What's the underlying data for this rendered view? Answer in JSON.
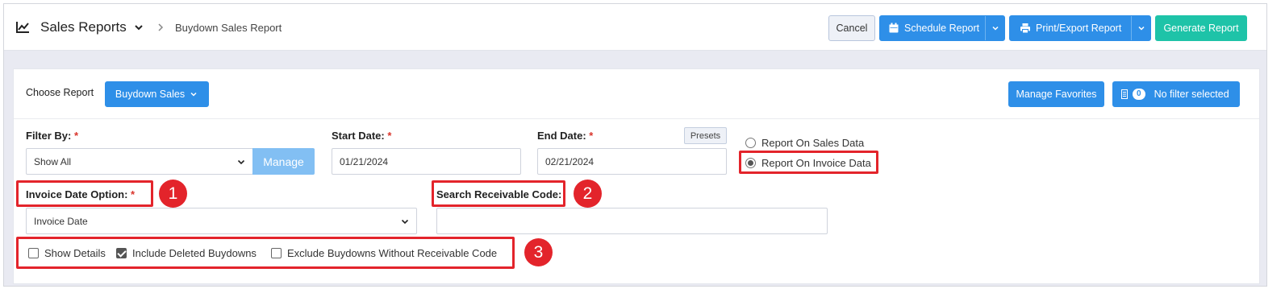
{
  "header": {
    "title": "Sales Reports",
    "breadcrumb": "Buydown Sales Report",
    "buttons": {
      "cancel": "Cancel",
      "schedule": "Schedule Report",
      "print": "Print/Export Report",
      "generate": "Generate Report"
    }
  },
  "toolbar": {
    "choose_label": "Choose Report",
    "report_dropdown": "Buydown Sales",
    "manage_favorites": "Manage Favorites",
    "filter_count": "0",
    "filter_text": "No filter selected"
  },
  "form": {
    "filter_by": {
      "label": "Filter By:",
      "value": "Show All",
      "manage": "Manage"
    },
    "start_date": {
      "label": "Start Date:",
      "value": "01/21/2024"
    },
    "end_date": {
      "label": "End Date:",
      "value": "02/21/2024",
      "presets": "Presets"
    },
    "report_on": [
      {
        "label": "Report On Sales Data",
        "selected": false
      },
      {
        "label": "Report On Invoice Data",
        "selected": true
      }
    ],
    "invoice_date_option": {
      "label": "Invoice Date Option:",
      "value": "Invoice Date"
    },
    "search_receivable": {
      "label": "Search Receivable Code:",
      "value": ""
    },
    "checkboxes": [
      {
        "label": "Show Details",
        "checked": false
      },
      {
        "label": "Include Deleted Buydowns",
        "checked": true
      },
      {
        "label": "Exclude Buydowns Without Receivable Code",
        "checked": false
      }
    ],
    "required_mark": "*"
  },
  "annotations": [
    "1",
    "2",
    "3"
  ],
  "colors": {
    "primary": "#2e8fe8",
    "success": "#1ec3a8",
    "highlight": "#e3242b",
    "required": "#d9342b"
  }
}
